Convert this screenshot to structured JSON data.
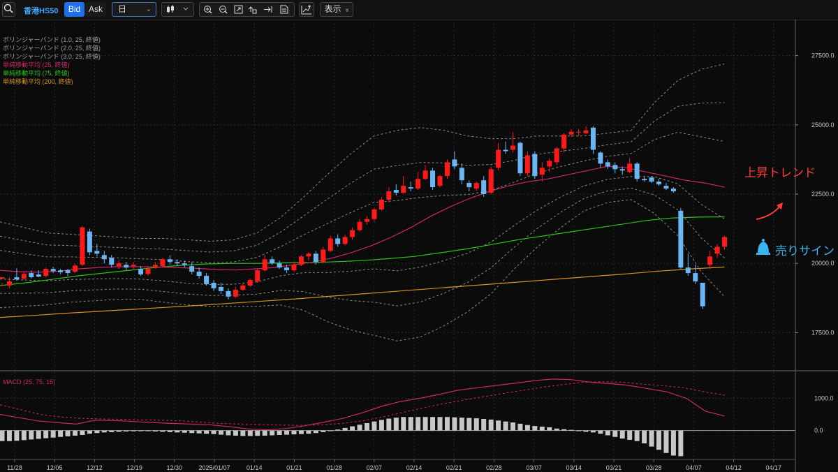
{
  "toolbar": {
    "symbol": "香港HS50",
    "bid_label": "Bid",
    "ask_label": "Ask",
    "timeframe": "日",
    "display_label": "表示",
    "display_chevron": "»"
  },
  "legend": {
    "bb1": "ボリンジャーバンド (1.0, 25, 終値)",
    "bb2": "ボリンジャーバンド (2.0, 25, 終値)",
    "bb3": "ボリンジャーバンド (3.0, 25, 終値)",
    "sma25": "単純移動平均 (25, 終値)",
    "sma75": "単純移動平均 (75, 終値)",
    "sma200": "単純移動平均 (200, 終値)",
    "macd": "MACD (25, 75, 15)"
  },
  "annotations": {
    "trend": "上昇トレンド",
    "signal": "売りサイン"
  },
  "colors": {
    "background": "#0b0b0b",
    "up": "#ff1a1a",
    "down": "#6ab6f5",
    "sma25": "#d0246e",
    "sma75": "#2fbf1e",
    "sma200": "#d89226",
    "bands": "#8a8a8a",
    "macd_line": "#d0246e",
    "macd_hist": "#c8c8c8",
    "accent": "#1f6feb",
    "signal": "#38b4ef",
    "trend": "#ff3b3b"
  },
  "chart_data": {
    "type": "candlestick",
    "y_ticks": [
      "27500.0",
      "25000.0",
      "22500.0",
      "20000.0",
      "17500.0"
    ],
    "y_tick_values": [
      27500,
      25000,
      22500,
      20000,
      17500
    ],
    "ylim": [
      16200,
      28800
    ],
    "x_ticks": [
      "11/28",
      "12/05",
      "12/12",
      "12/19",
      "12/30",
      "2025/01/07",
      "01/14",
      "01/21",
      "01/28",
      "02/07",
      "02/14",
      "02/21",
      "02/28",
      "03/07",
      "03/14",
      "03/21",
      "03/28",
      "04/07",
      "04/12",
      "04/17"
    ],
    "candles": [
      [
        19450,
        19500,
        19300,
        19200
      ],
      [
        19200,
        19350,
        19500,
        19100
      ],
      [
        19500,
        19420,
        19820,
        19380
      ],
      [
        19450,
        19620,
        19700,
        19400
      ],
      [
        19650,
        19500,
        19750,
        19450
      ],
      [
        19600,
        19520,
        19750,
        19500
      ],
      [
        19550,
        19800,
        19850,
        19500
      ],
      [
        19800,
        19720,
        19880,
        19650
      ],
      [
        19750,
        19680,
        19800,
        19600
      ],
      [
        19750,
        19650,
        19800,
        19550
      ],
      [
        19700,
        19920,
        19980,
        19650
      ],
      [
        19950,
        21300,
        21350,
        19900
      ],
      [
        21150,
        20400,
        21250,
        20300
      ],
      [
        20450,
        20350,
        20700,
        20250
      ],
      [
        20300,
        20150,
        20450,
        20000
      ],
      [
        20200,
        19950,
        20300,
        19850
      ],
      [
        19900,
        20000,
        20100,
        19800
      ],
      [
        19950,
        19850,
        20050,
        19750
      ],
      [
        19900,
        19950,
        20050,
        19800
      ],
      [
        19800,
        19600,
        19900,
        19550
      ],
      [
        19620,
        19800,
        19900,
        19550
      ],
      [
        19850,
        19950,
        20050,
        19800
      ],
      [
        19900,
        20150,
        20200,
        19850
      ],
      [
        20150,
        20050,
        20300,
        19950
      ],
      [
        20050,
        20000,
        20150,
        19900
      ],
      [
        20000,
        19950,
        20100,
        19850
      ],
      [
        19900,
        19700,
        20050,
        19600
      ],
      [
        19700,
        19550,
        19850,
        19450
      ],
      [
        19550,
        19250,
        19650,
        19200
      ],
      [
        19300,
        19100,
        19400,
        19000
      ],
      [
        19150,
        19000,
        19300,
        18900
      ],
      [
        19000,
        18800,
        19100,
        18700
      ],
      [
        18800,
        19050,
        19150,
        18750
      ],
      [
        19050,
        19200,
        19300,
        19000
      ],
      [
        19200,
        19400,
        19450,
        19150
      ],
      [
        19350,
        19750,
        19800,
        19300
      ],
      [
        19750,
        20150,
        20300,
        19700
      ],
      [
        20150,
        20000,
        20250,
        19950
      ],
      [
        20000,
        19850,
        20100,
        19800
      ],
      [
        19850,
        19750,
        19950,
        19650
      ],
      [
        19750,
        19950,
        20050,
        19700
      ],
      [
        19950,
        20250,
        20300,
        19900
      ],
      [
        20250,
        20350,
        20400,
        20100
      ],
      [
        20350,
        20050,
        20450,
        19950
      ],
      [
        20050,
        20500,
        20600,
        20000
      ],
      [
        20450,
        20900,
        21000,
        20400
      ],
      [
        20900,
        20700,
        21050,
        20600
      ],
      [
        20700,
        20950,
        21050,
        20650
      ],
      [
        20950,
        21200,
        21300,
        20850
      ],
      [
        21200,
        21500,
        21600,
        21150
      ],
      [
        21500,
        21600,
        21700,
        21400
      ],
      [
        21600,
        21950,
        22000,
        21500
      ],
      [
        21950,
        22300,
        22400,
        21900
      ],
      [
        22300,
        22600,
        22750,
        22200
      ],
      [
        22650,
        22550,
        22850,
        22450
      ],
      [
        22550,
        22800,
        23150,
        22500
      ],
      [
        22750,
        22700,
        22950,
        22600
      ],
      [
        22700,
        23050,
        23300,
        22650
      ],
      [
        23050,
        23350,
        23550,
        23000
      ],
      [
        23350,
        22750,
        23450,
        22650
      ],
      [
        22800,
        23150,
        23200,
        22750
      ],
      [
        23150,
        23650,
        23750,
        23050
      ],
      [
        23750,
        23500,
        24050,
        23400
      ],
      [
        23450,
        23000,
        23600,
        22850
      ],
      [
        22900,
        22750,
        23000,
        22600
      ],
      [
        22700,
        22900,
        22950,
        22600
      ],
      [
        23000,
        22500,
        23150,
        22400
      ],
      [
        22550,
        23400,
        23500,
        22500
      ],
      [
        23450,
        24100,
        24350,
        23350
      ],
      [
        24100,
        24050,
        24400,
        23950
      ],
      [
        24100,
        24250,
        24750,
        24000
      ],
      [
        24350,
        23250,
        24400,
        23150
      ],
      [
        23250,
        23900,
        24050,
        23150
      ],
      [
        23950,
        23150,
        24050,
        23050
      ],
      [
        23200,
        23450,
        23650,
        22950
      ],
      [
        23500,
        23700,
        23800,
        23300
      ],
      [
        23650,
        24150,
        24200,
        23550
      ],
      [
        24150,
        24650,
        24700,
        24000
      ],
      [
        24650,
        24750,
        24850,
        24550
      ],
      [
        24750,
        24750,
        24850,
        24600
      ],
      [
        24700,
        24800,
        24950,
        24650
      ],
      [
        24900,
        24100,
        24950,
        23950
      ],
      [
        24000,
        23600,
        24050,
        23450
      ],
      [
        23650,
        23500,
        23750,
        23400
      ],
      [
        23550,
        23400,
        23650,
        23250
      ],
      [
        23400,
        23350,
        23500,
        23200
      ],
      [
        23300,
        23600,
        23800,
        23250
      ],
      [
        23600,
        23050,
        23650,
        22950
      ],
      [
        23050,
        23000,
        23150,
        22950
      ],
      [
        23100,
        22950,
        23150,
        22900
      ],
      [
        22950,
        22850,
        23050,
        22800
      ],
      [
        22800,
        22700,
        22900,
        22650
      ],
      [
        22700,
        22600,
        22750,
        22550
      ],
      [
        21900,
        19850,
        22000,
        19800
      ],
      [
        19850,
        19650,
        20350,
        19550
      ],
      [
        19650,
        19350,
        19950,
        19250
      ],
      [
        19300,
        18450,
        19300,
        18350
      ],
      [
        19950,
        20250,
        20450,
        19800
      ],
      [
        20350,
        20600,
        20700,
        20200
      ],
      [
        20600,
        20950,
        21000,
        20500
      ]
    ],
    "drawn_candles": 100,
    "sma25": [
      19750,
      19700,
      19680,
      19720,
      19800,
      19850,
      19880,
      19880,
      19870,
      19850,
      19820,
      19780,
      19760,
      19800,
      19850,
      19950,
      20050,
      20200,
      20400,
      20650,
      20950,
      21300,
      21700,
      22050,
      22350,
      22600,
      22800,
      22950,
      23050,
      23200,
      23350,
      23500,
      23450,
      23300,
      23150,
      23000,
      22900,
      22750
    ],
    "sma75": [
      19200,
      19300,
      19420,
      19550,
      19650,
      19750,
      19850,
      19930,
      19980,
      20000,
      20000,
      20020,
      20030,
      20060,
      20100,
      20170,
      20250,
      20380,
      20520,
      20680,
      20850,
      20990,
      21130,
      21270,
      21410,
      21550,
      21640,
      21670,
      21680
    ],
    "sma200": [
      18050,
      18120,
      18200,
      18270,
      18340,
      18410,
      18480,
      18560,
      18640,
      18720,
      18810,
      18900,
      18990,
      19080,
      19170,
      19260,
      19350,
      19440,
      19530,
      19620,
      19720,
      19800,
      19870
    ],
    "bb_upper3": [
      21500,
      21300,
      21100,
      21050,
      21000,
      20950,
      20900,
      20900,
      20850,
      20800,
      20850,
      21100,
      21650,
      22400,
      23200,
      23950,
      24600,
      24800,
      24900,
      24800,
      24600,
      24500,
      24500,
      24600,
      24600,
      24600,
      24700,
      24800,
      25800,
      26600,
      27000,
      27200
    ],
    "bb_lower3": [
      18400,
      18450,
      18500,
      18600,
      18650,
      18700,
      18700,
      18600,
      18500,
      18450,
      18450,
      18450,
      18500,
      18300,
      17900,
      17600,
      17400,
      17200,
      17350,
      17750,
      18250,
      18900,
      19800,
      20600,
      21300,
      21900,
      22200,
      22300,
      21800,
      21000,
      19700,
      18800
    ],
    "macd": {
      "ylim": [
        -900,
        1750
      ],
      "y_ticks": [
        "1000.0",
        "0.0"
      ],
      "y_tick_values": [
        1000,
        0
      ],
      "macd_line": [
        500,
        400,
        300,
        250,
        200,
        320,
        310,
        280,
        250,
        220,
        200,
        180,
        120,
        50,
        20,
        60,
        150,
        260,
        380,
        550,
        750,
        900,
        1000,
        1120,
        1250,
        1330,
        1400,
        1470,
        1550,
        1600,
        1580,
        1500,
        1460,
        1400,
        1300,
        1200,
        1000,
        600,
        450
      ],
      "signal_line": [
        800,
        650,
        500,
        420,
        380,
        360,
        350,
        330,
        320,
        300,
        260,
        220,
        200,
        180,
        170,
        160,
        180,
        220,
        300,
        420,
        560,
        700,
        830,
        940,
        1050,
        1150,
        1250,
        1350,
        1430,
        1500,
        1520,
        1500,
        1440,
        1390,
        1330,
        1200,
        1100
      ],
      "histogram": [
        -330,
        -330,
        -320,
        -300,
        -280,
        -260,
        -240,
        -220,
        -200,
        -180,
        -160,
        -140,
        -100,
        -80,
        -60,
        -50,
        -40,
        -30,
        -25,
        -20,
        -20,
        -30,
        -40,
        -50,
        -60,
        -70,
        -80,
        -90,
        -100,
        -110,
        -130,
        -150,
        -160,
        -170,
        -170,
        -165,
        -160,
        -150,
        -140,
        -130,
        -120,
        -110,
        -100,
        -80,
        -50,
        -20,
        30,
        80,
        130,
        180,
        230,
        280,
        330,
        370,
        400,
        420,
        420,
        420,
        420,
        420,
        420,
        420,
        410,
        400,
        390,
        380,
        360,
        340,
        310,
        280,
        250,
        210,
        170,
        140,
        120,
        100,
        60,
        40,
        20,
        -20,
        -40,
        -60,
        -100,
        -150,
        -200,
        -250,
        -290,
        -330,
        -400,
        -500,
        -600,
        -700,
        -780,
        -800
      ]
    }
  }
}
